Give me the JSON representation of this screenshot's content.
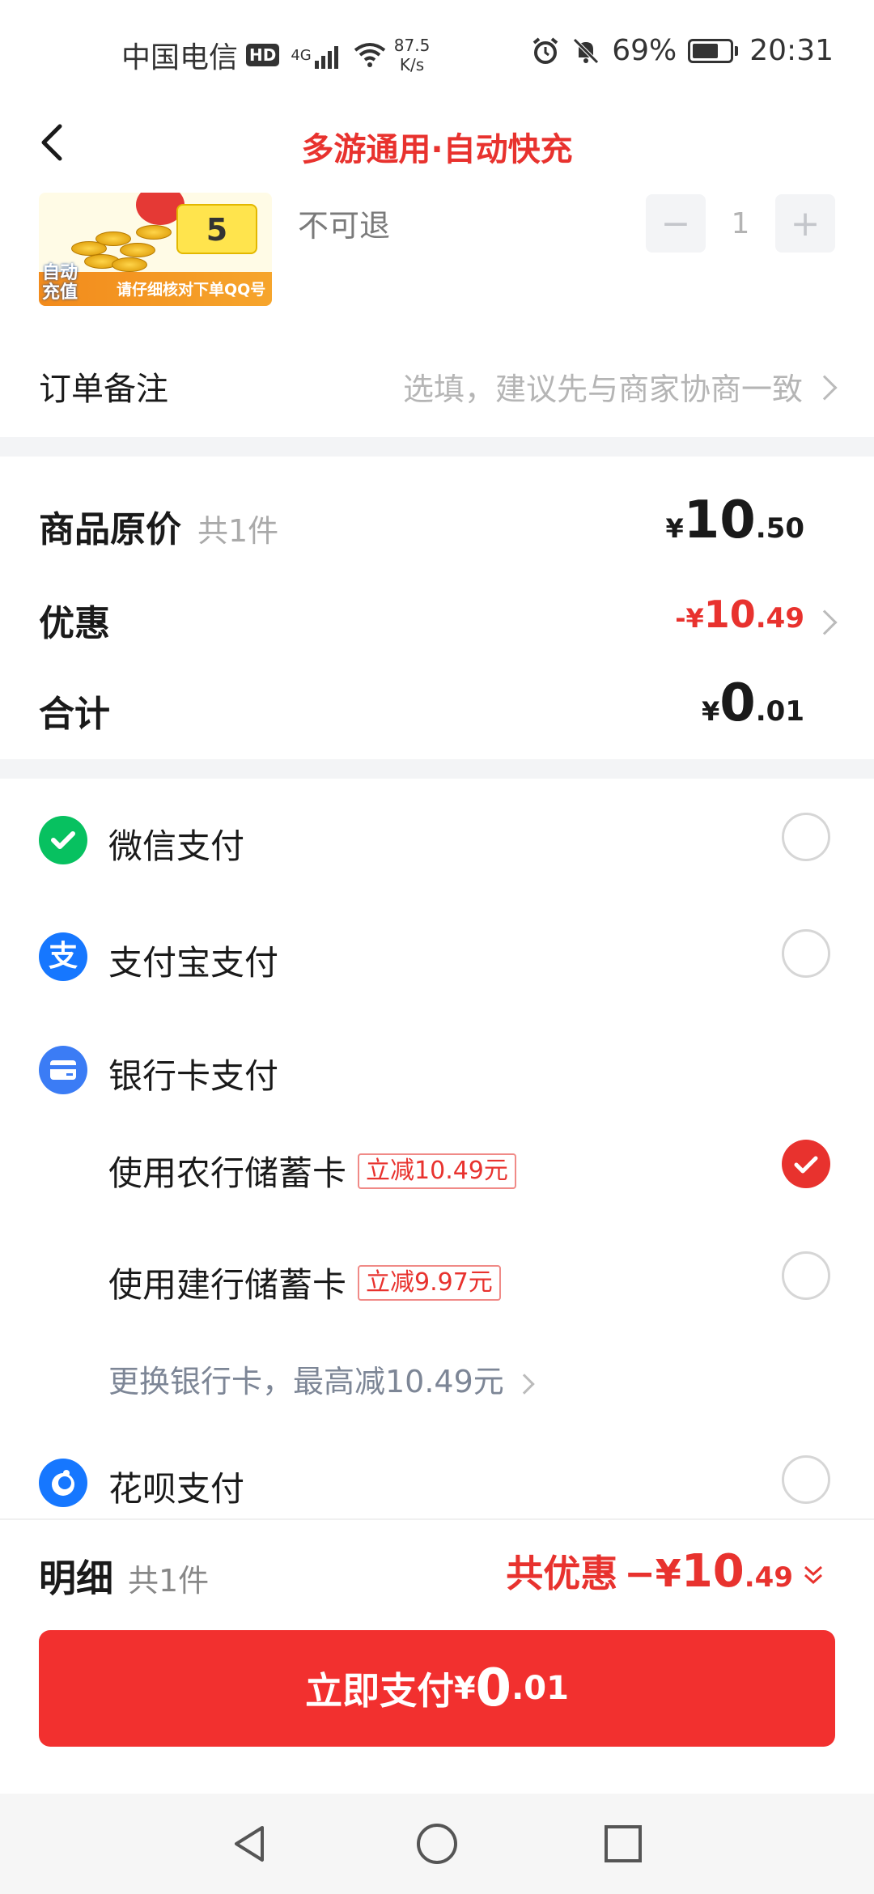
{
  "status_bar": {
    "carrier": "中国电信",
    "hd": "HD",
    "network": "4G",
    "speed_value": "87.5",
    "speed_unit": "K/s",
    "battery": "69%",
    "battery_level": 0.69,
    "time": "20:31"
  },
  "header": {
    "title": "多游通用·自动快充"
  },
  "product": {
    "thumb_auto": "自动\n充值",
    "thumb_number": "5",
    "thumb_caption": "请仔细核对下单QQ号",
    "refund_text": "不可退",
    "quantity": "1",
    "minus": "−",
    "plus": "+"
  },
  "remark": {
    "label": "订单备注",
    "placeholder": "选填，建议先与商家协商一致"
  },
  "summary": {
    "original_label": "商品原价",
    "original_count": "共1件",
    "original_price": {
      "cur": "¥",
      "int": "10",
      "dec": ".50"
    },
    "discount_label": "优惠",
    "discount_price": {
      "cur": "-¥",
      "int": "10",
      "dec": ".49"
    },
    "total_label": "合计",
    "total_price": {
      "cur": "¥",
      "int": "0",
      "dec": ".01"
    }
  },
  "payment": {
    "wechat": "微信支付",
    "alipay": "支付宝支付",
    "bank": "银行卡支付",
    "abc_card": "使用农行储蓄卡",
    "abc_promo": "立减10.49元",
    "ccb_card": "使用建行储蓄卡",
    "ccb_promo": "立减9.97元",
    "change_card": "更换银行卡，最高减10.49元",
    "huabei": "花呗支付",
    "selected": "abc_card"
  },
  "bottom": {
    "detail_label": "明细",
    "detail_count": "共1件",
    "total_discount_label": "共优惠",
    "total_discount": {
      "cur": "−¥",
      "int": "10",
      "dec": ".49"
    },
    "pay_label": "立即支付",
    "pay_amount": {
      "cur": "¥",
      "int": "0",
      "dec": ".01"
    }
  },
  "colors": {
    "accent": "#e8322e",
    "wechat": "#07c160",
    "alipay": "#1677ff",
    "bank": "#3b7cf5"
  }
}
